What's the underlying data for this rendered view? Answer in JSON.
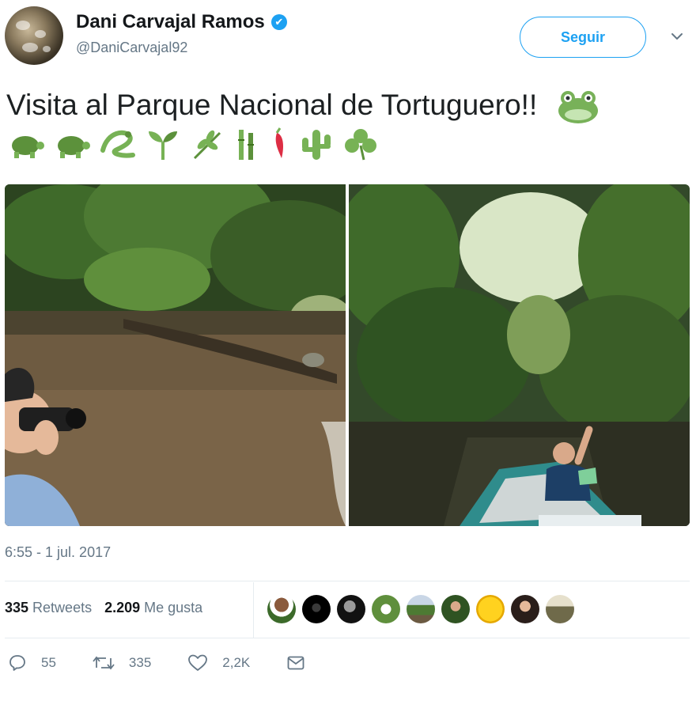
{
  "user": {
    "display_name": "Dani Carvajal Ramos",
    "verified_mark": "✔",
    "handle": "@DaniCarvajal92"
  },
  "follow_label": "Seguir",
  "tweet": {
    "text": "Visita al Parque Nacional de Tortuguero!!",
    "emojis": [
      "frog",
      "turtle",
      "turtle",
      "lizard",
      "seedling",
      "herb",
      "bamboo",
      "hot-pepper",
      "cactus",
      "shamrock"
    ]
  },
  "timestamp": "6:55 - 1 jul. 2017",
  "stats": {
    "retweets_count": "335",
    "retweets_label": "Retweets",
    "likes_count": "2.209",
    "likes_label": "Me gusta"
  },
  "actions": {
    "replies": "55",
    "retweets": "335",
    "likes": "2,2K"
  },
  "colors": {
    "accent": "#1da1f2",
    "muted": "#657786",
    "text": "#14171a"
  },
  "icons": [
    "verified-badge-icon",
    "chevron-down-icon",
    "reply-icon",
    "retweet-icon",
    "like-icon",
    "message-icon"
  ]
}
